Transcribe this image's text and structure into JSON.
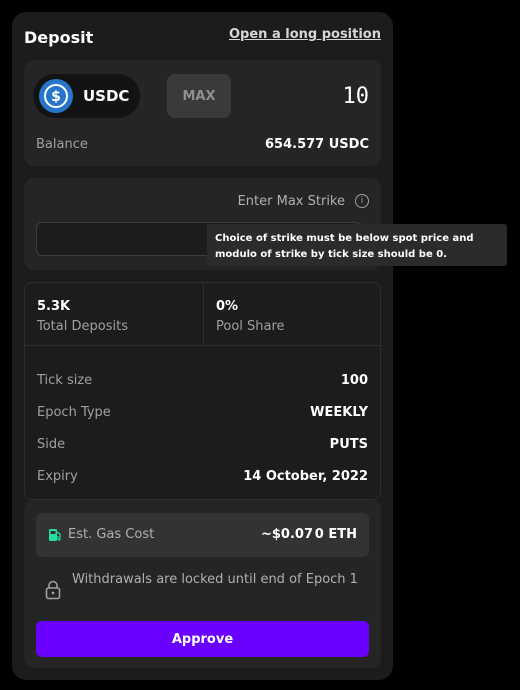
{
  "header": {
    "title": "Deposit",
    "link": "Open a long position"
  },
  "deposit": {
    "token": "USDC",
    "token_icon": "usdc-logo",
    "max_label": "MAX",
    "amount": "10",
    "balance_label": "Balance",
    "balance_value": "654.577 USDC"
  },
  "strike": {
    "label": "Enter Max Strike",
    "input_value": "",
    "tooltip": "Choice of strike must be below spot price and modulo of strike by tick size should be 0."
  },
  "stats": [
    {
      "value": "5.3K",
      "label": "Total Deposits"
    },
    {
      "value": "0%",
      "label": "Pool Share"
    }
  ],
  "details": [
    {
      "label": "Tick size",
      "value": "100"
    },
    {
      "label": "Epoch Type",
      "value": "WEEKLY"
    },
    {
      "label": "Side",
      "value": "PUTS"
    },
    {
      "label": "Expiry",
      "value": "14 October, 2022"
    }
  ],
  "gas": {
    "label": "Est. Gas Cost",
    "usd": "~$0.07",
    "eth": "0 ETH"
  },
  "lock_text": "Withdrawals are locked until end of Epoch 1",
  "approve_label": "Approve",
  "colors": {
    "accent": "#6a00ff",
    "usdc_blue": "#2775ca",
    "gas_green": "#22e1a0"
  }
}
